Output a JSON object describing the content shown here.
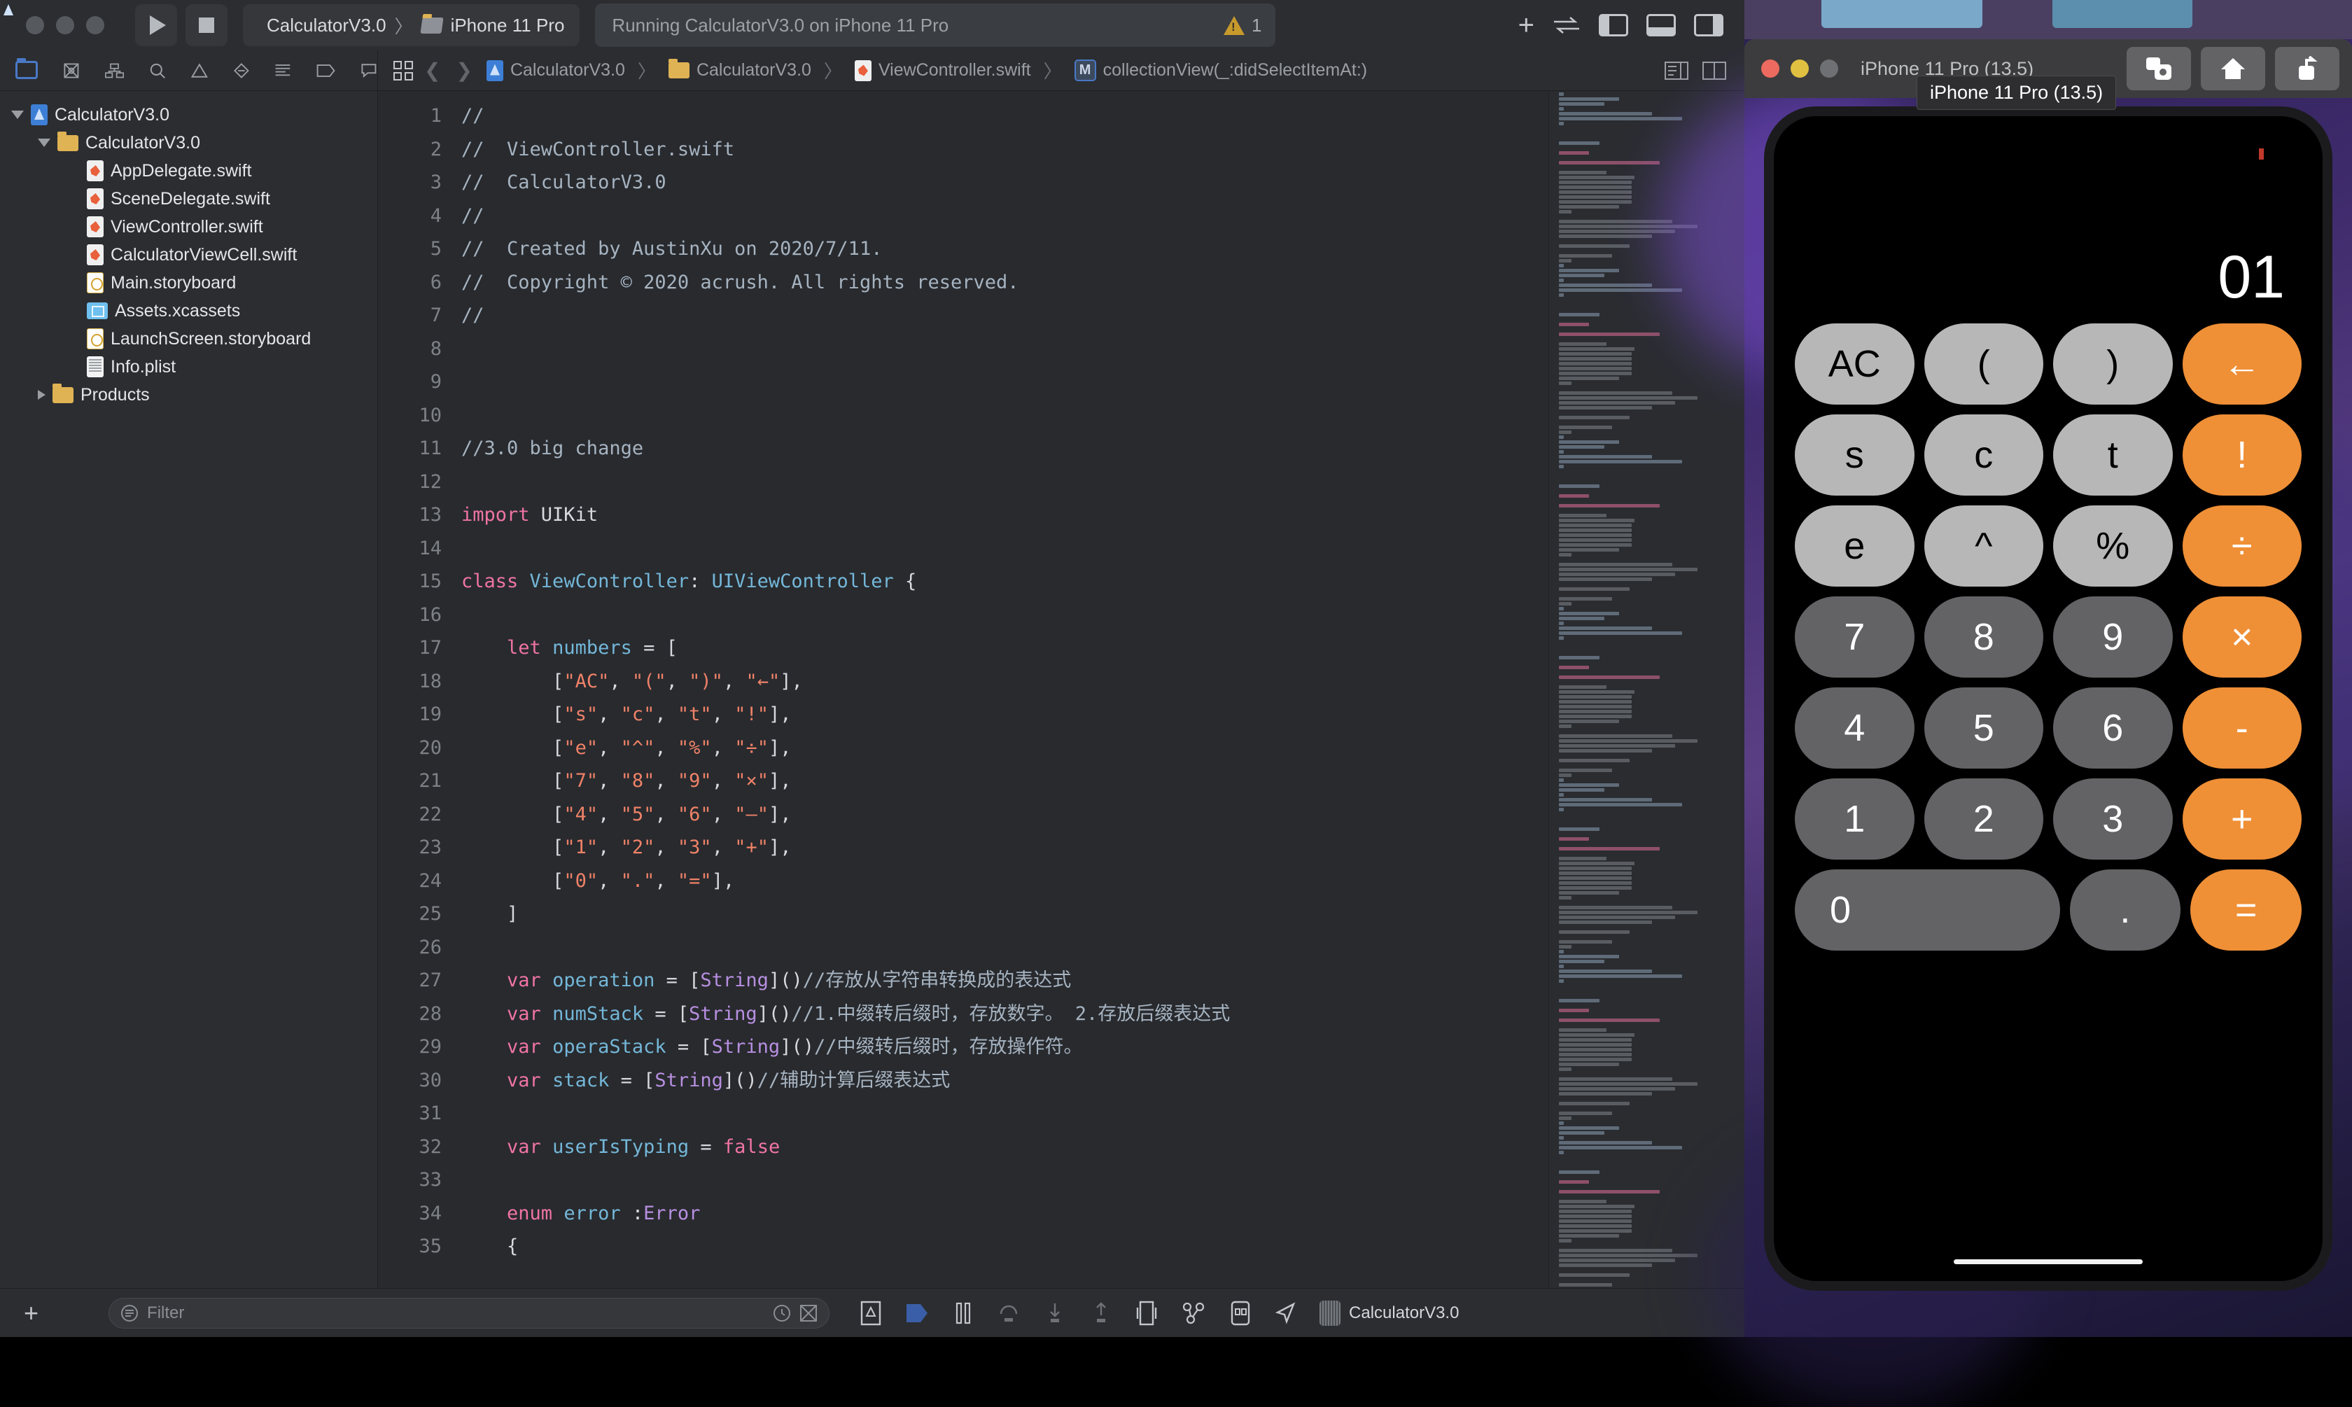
{
  "xcode": {
    "toolbar": {
      "run_button": "run-button",
      "stop_button": "stop-button",
      "scheme_name": "CalculatorV3.0",
      "scheme_sep": "〉",
      "destination": "iPhone 11 Pro",
      "status_text": "Running CalculatorV3.0 on iPhone 11 Pro",
      "warning_count": "1",
      "add_label": "+"
    },
    "breadcrumb": {
      "items": [
        {
          "label": "CalculatorV3.0",
          "icon": "project-icon"
        },
        {
          "label": "CalculatorV3.0",
          "icon": "folder-icon"
        },
        {
          "label": "ViewController.swift",
          "icon": "swift-file-icon"
        },
        {
          "label": "collectionView(_:didSelectItemAt:)",
          "icon": "method-badge-icon"
        }
      ],
      "separator": "〉",
      "method_badge": "M"
    },
    "navigator": {
      "tabs": [
        "folder-icon",
        "source-control-icon",
        "symbol-icon",
        "search-icon",
        "issue-icon",
        "test-icon",
        "debug-icon",
        "breakpoint-icon",
        "report-icon"
      ],
      "tree": [
        {
          "label": "CalculatorV3.0",
          "indent": 0,
          "icon": "project-icon",
          "arrow": "open"
        },
        {
          "label": "CalculatorV3.0",
          "indent": 1,
          "icon": "folder-icon",
          "arrow": "open"
        },
        {
          "label": "AppDelegate.swift",
          "indent": 2,
          "icon": "swift-file-icon",
          "arrow": "none"
        },
        {
          "label": "SceneDelegate.swift",
          "indent": 2,
          "icon": "swift-file-icon",
          "arrow": "none"
        },
        {
          "label": "ViewController.swift",
          "indent": 2,
          "icon": "swift-file-icon",
          "arrow": "none"
        },
        {
          "label": "CalculatorViewCell.swift",
          "indent": 2,
          "icon": "swift-file-icon",
          "arrow": "none"
        },
        {
          "label": "Main.storyboard",
          "indent": 2,
          "icon": "storyboard-icon",
          "arrow": "none"
        },
        {
          "label": "Assets.xcassets",
          "indent": 2,
          "icon": "assets-icon",
          "arrow": "none"
        },
        {
          "label": "LaunchScreen.storyboard",
          "indent": 2,
          "icon": "storyboard-icon",
          "arrow": "none"
        },
        {
          "label": "Info.plist",
          "indent": 2,
          "icon": "plist-icon",
          "arrow": "none"
        },
        {
          "label": "Products",
          "indent": 1,
          "icon": "folder-icon",
          "arrow": "closed"
        }
      ]
    },
    "editor": {
      "lines": [
        {
          "n": "1",
          "tokens": [
            {
              "t": "//",
              "c": "com"
            }
          ]
        },
        {
          "n": "2",
          "tokens": [
            {
              "t": "//  ViewController.swift",
              "c": "com"
            }
          ]
        },
        {
          "n": "3",
          "tokens": [
            {
              "t": "//  CalculatorV3.0",
              "c": "com"
            }
          ]
        },
        {
          "n": "4",
          "tokens": [
            {
              "t": "//",
              "c": "com"
            }
          ]
        },
        {
          "n": "5",
          "tokens": [
            {
              "t": "//  Created by AustinXu on 2020/7/11.",
              "c": "com"
            }
          ]
        },
        {
          "n": "6",
          "tokens": [
            {
              "t": "//  Copyright © 2020 acrush. All rights reserved.",
              "c": "com"
            }
          ]
        },
        {
          "n": "7",
          "tokens": [
            {
              "t": "//",
              "c": "com"
            }
          ]
        },
        {
          "n": "8",
          "tokens": []
        },
        {
          "n": "9",
          "tokens": []
        },
        {
          "n": "10",
          "tokens": []
        },
        {
          "n": "11",
          "tokens": [
            {
              "t": "//3.0 big change",
              "c": "com"
            }
          ]
        },
        {
          "n": "12",
          "tokens": []
        },
        {
          "n": "13",
          "tokens": [
            {
              "t": "import ",
              "c": "kw"
            },
            {
              "t": "UIKit",
              "c": "plain"
            }
          ]
        },
        {
          "n": "14",
          "tokens": []
        },
        {
          "n": "15",
          "tokens": [
            {
              "t": "class ",
              "c": "kw"
            },
            {
              "t": "ViewController",
              "c": "id"
            },
            {
              "t": ": ",
              "c": "plain"
            },
            {
              "t": "UIViewController",
              "c": "id"
            },
            {
              "t": " {",
              "c": "plain"
            }
          ]
        },
        {
          "n": "16",
          "tokens": []
        },
        {
          "n": "17",
          "tokens": [
            {
              "t": "    ",
              "c": "plain"
            },
            {
              "t": "let ",
              "c": "kw"
            },
            {
              "t": "numbers",
              "c": "id"
            },
            {
              "t": " = [",
              "c": "plain"
            }
          ]
        },
        {
          "n": "18",
          "tokens": [
            {
              "t": "        [",
              "c": "plain"
            },
            {
              "t": "\"AC\"",
              "c": "str"
            },
            {
              "t": ", ",
              "c": "plain"
            },
            {
              "t": "\"(\"",
              "c": "str"
            },
            {
              "t": ", ",
              "c": "plain"
            },
            {
              "t": "\")\"",
              "c": "str"
            },
            {
              "t": ", ",
              "c": "plain"
            },
            {
              "t": "\"←\"",
              "c": "str"
            },
            {
              "t": "],",
              "c": "plain"
            }
          ]
        },
        {
          "n": "19",
          "tokens": [
            {
              "t": "        [",
              "c": "plain"
            },
            {
              "t": "\"s\"",
              "c": "str"
            },
            {
              "t": ", ",
              "c": "plain"
            },
            {
              "t": "\"c\"",
              "c": "str"
            },
            {
              "t": ", ",
              "c": "plain"
            },
            {
              "t": "\"t\"",
              "c": "str"
            },
            {
              "t": ", ",
              "c": "plain"
            },
            {
              "t": "\"!\"",
              "c": "str"
            },
            {
              "t": "],",
              "c": "plain"
            }
          ]
        },
        {
          "n": "20",
          "tokens": [
            {
              "t": "        [",
              "c": "plain"
            },
            {
              "t": "\"e\"",
              "c": "str"
            },
            {
              "t": ", ",
              "c": "plain"
            },
            {
              "t": "\"^\"",
              "c": "str"
            },
            {
              "t": ", ",
              "c": "plain"
            },
            {
              "t": "\"%\"",
              "c": "str"
            },
            {
              "t": ", ",
              "c": "plain"
            },
            {
              "t": "\"÷\"",
              "c": "str"
            },
            {
              "t": "],",
              "c": "plain"
            }
          ]
        },
        {
          "n": "21",
          "tokens": [
            {
              "t": "        [",
              "c": "plain"
            },
            {
              "t": "\"7\"",
              "c": "str"
            },
            {
              "t": ", ",
              "c": "plain"
            },
            {
              "t": "\"8\"",
              "c": "str"
            },
            {
              "t": ", ",
              "c": "plain"
            },
            {
              "t": "\"9\"",
              "c": "str"
            },
            {
              "t": ", ",
              "c": "plain"
            },
            {
              "t": "\"×\"",
              "c": "str"
            },
            {
              "t": "],",
              "c": "plain"
            }
          ]
        },
        {
          "n": "22",
          "tokens": [
            {
              "t": "        [",
              "c": "plain"
            },
            {
              "t": "\"4\"",
              "c": "str"
            },
            {
              "t": ", ",
              "c": "plain"
            },
            {
              "t": "\"5\"",
              "c": "str"
            },
            {
              "t": ", ",
              "c": "plain"
            },
            {
              "t": "\"6\"",
              "c": "str"
            },
            {
              "t": ", ",
              "c": "plain"
            },
            {
              "t": "\"—\"",
              "c": "str"
            },
            {
              "t": "],",
              "c": "plain"
            }
          ]
        },
        {
          "n": "23",
          "tokens": [
            {
              "t": "        [",
              "c": "plain"
            },
            {
              "t": "\"1\"",
              "c": "str"
            },
            {
              "t": ", ",
              "c": "plain"
            },
            {
              "t": "\"2\"",
              "c": "str"
            },
            {
              "t": ", ",
              "c": "plain"
            },
            {
              "t": "\"3\"",
              "c": "str"
            },
            {
              "t": ", ",
              "c": "plain"
            },
            {
              "t": "\"+\"",
              "c": "str"
            },
            {
              "t": "],",
              "c": "plain"
            }
          ]
        },
        {
          "n": "24",
          "tokens": [
            {
              "t": "        [",
              "c": "plain"
            },
            {
              "t": "\"0\"",
              "c": "str"
            },
            {
              "t": ", ",
              "c": "plain"
            },
            {
              "t": "\".\"",
              "c": "str"
            },
            {
              "t": ", ",
              "c": "plain"
            },
            {
              "t": "\"=\"",
              "c": "str"
            },
            {
              "t": "],",
              "c": "plain"
            }
          ]
        },
        {
          "n": "25",
          "tokens": [
            {
              "t": "    ]",
              "c": "plain"
            }
          ]
        },
        {
          "n": "26",
          "tokens": []
        },
        {
          "n": "27",
          "tokens": [
            {
              "t": "    ",
              "c": "plain"
            },
            {
              "t": "var ",
              "c": "kw"
            },
            {
              "t": "operation",
              "c": "id"
            },
            {
              "t": " = [",
              "c": "plain"
            },
            {
              "t": "String",
              "c": "type"
            },
            {
              "t": "]()",
              "c": "plain"
            },
            {
              "t": "//存放从字符串转换成的表达式",
              "c": "com"
            }
          ]
        },
        {
          "n": "28",
          "tokens": [
            {
              "t": "    ",
              "c": "plain"
            },
            {
              "t": "var ",
              "c": "kw"
            },
            {
              "t": "numStack",
              "c": "id"
            },
            {
              "t": " = [",
              "c": "plain"
            },
            {
              "t": "String",
              "c": "type"
            },
            {
              "t": "]()",
              "c": "plain"
            },
            {
              "t": "//1.中缀转后缀时，存放数字。 2.存放后缀表达式",
              "c": "com"
            }
          ]
        },
        {
          "n": "29",
          "tokens": [
            {
              "t": "    ",
              "c": "plain"
            },
            {
              "t": "var ",
              "c": "kw"
            },
            {
              "t": "operaStack",
              "c": "id"
            },
            {
              "t": " = [",
              "c": "plain"
            },
            {
              "t": "String",
              "c": "type"
            },
            {
              "t": "]()",
              "c": "plain"
            },
            {
              "t": "//中缀转后缀时，存放操作符。",
              "c": "com"
            }
          ]
        },
        {
          "n": "30",
          "tokens": [
            {
              "t": "    ",
              "c": "plain"
            },
            {
              "t": "var ",
              "c": "kw"
            },
            {
              "t": "stack",
              "c": "id"
            },
            {
              "t": " = [",
              "c": "plain"
            },
            {
              "t": "String",
              "c": "type"
            },
            {
              "t": "]()",
              "c": "plain"
            },
            {
              "t": "//辅助计算后缀表达式",
              "c": "com"
            }
          ]
        },
        {
          "n": "31",
          "tokens": []
        },
        {
          "n": "32",
          "tokens": [
            {
              "t": "    ",
              "c": "plain"
            },
            {
              "t": "var ",
              "c": "kw"
            },
            {
              "t": "userIsTyping",
              "c": "id"
            },
            {
              "t": " = ",
              "c": "plain"
            },
            {
              "t": "false",
              "c": "kw"
            }
          ]
        },
        {
          "n": "33",
          "tokens": []
        },
        {
          "n": "34",
          "tokens": [
            {
              "t": "    ",
              "c": "plain"
            },
            {
              "t": "enum ",
              "c": "kw"
            },
            {
              "t": "error",
              "c": "id"
            },
            {
              "t": " :",
              "c": "plain"
            },
            {
              "t": "Error",
              "c": "type"
            }
          ]
        },
        {
          "n": "35",
          "tokens": [
            {
              "t": "    {",
              "c": "plain"
            }
          ]
        }
      ]
    },
    "bottom_bar": {
      "add_label": "+",
      "filter_placeholder": "Filter",
      "debug_target": "CalculatorV3.0"
    }
  },
  "simulator": {
    "title": "iPhone 11 Pro (13.5)",
    "tooltip": "iPhone 11 Pro (13.5)",
    "toolbar_buttons": [
      "screenshot-icon",
      "home-icon",
      "share-icon"
    ],
    "traffic_colors": {
      "close": "#ec6a5f",
      "minimize": "#e0c040",
      "zoom": "#6f7073"
    },
    "app": {
      "display_value": "01",
      "accent_color": "#ef8f36",
      "light_key_color": "#b7b7b7",
      "dark_key_color": "#636366",
      "keypad": [
        [
          {
            "label": "AC",
            "style": "lite"
          },
          {
            "label": "(",
            "style": "lite"
          },
          {
            "label": ")",
            "style": "lite"
          },
          {
            "label": "←",
            "style": "acc"
          }
        ],
        [
          {
            "label": "s",
            "style": "lite"
          },
          {
            "label": "c",
            "style": "lite"
          },
          {
            "label": "t",
            "style": "lite"
          },
          {
            "label": "!",
            "style": "acc"
          }
        ],
        [
          {
            "label": "e",
            "style": "lite"
          },
          {
            "label": "^",
            "style": "lite"
          },
          {
            "label": "%",
            "style": "lite"
          },
          {
            "label": "÷",
            "style": "acc"
          }
        ],
        [
          {
            "label": "7",
            "style": "dark"
          },
          {
            "label": "8",
            "style": "dark"
          },
          {
            "label": "9",
            "style": "dark"
          },
          {
            "label": "×",
            "style": "acc"
          }
        ],
        [
          {
            "label": "4",
            "style": "dark"
          },
          {
            "label": "5",
            "style": "dark"
          },
          {
            "label": "6",
            "style": "dark"
          },
          {
            "label": "-",
            "style": "acc"
          }
        ],
        [
          {
            "label": "1",
            "style": "dark"
          },
          {
            "label": "2",
            "style": "dark"
          },
          {
            "label": "3",
            "style": "dark"
          },
          {
            "label": "+",
            "style": "acc"
          }
        ],
        [
          {
            "label": "0",
            "style": "dark wide"
          },
          {
            "label": ".",
            "style": "dark"
          },
          {
            "label": "=",
            "style": "acc"
          }
        ]
      ]
    }
  }
}
